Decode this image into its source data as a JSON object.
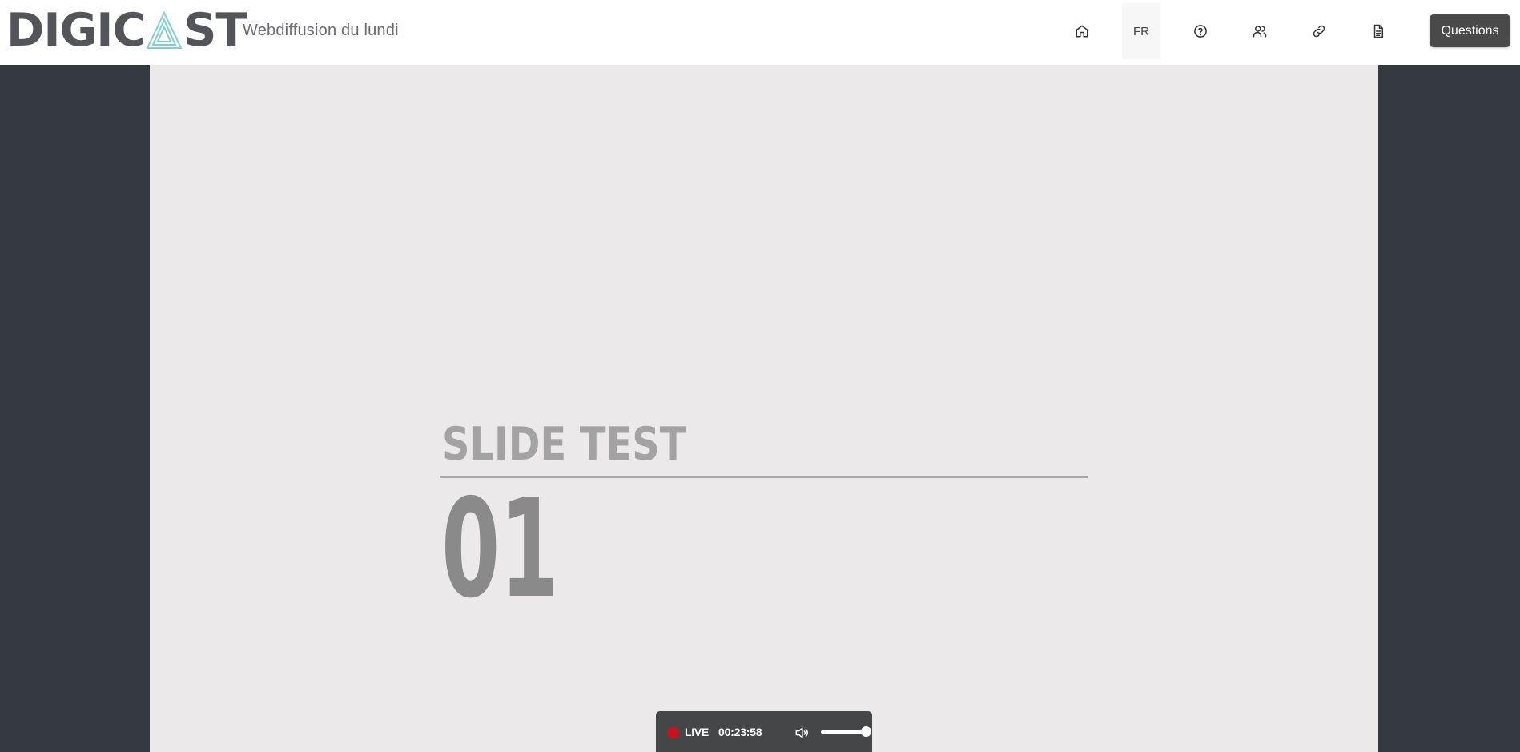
{
  "header": {
    "logo_left": "DIGIC",
    "logo_right": "ST",
    "event_title": "Webdiffusion du lundi",
    "language": "FR",
    "questions_label": "Questions",
    "nav_icons": [
      "home-icon",
      "help-circle-icon",
      "users-icon",
      "link-icon",
      "document-icon"
    ]
  },
  "slide": {
    "title": "SLIDE TEST",
    "number": "01"
  },
  "player": {
    "live_label": "LIVE",
    "elapsed": "00:23:58",
    "volume_level": 1.0
  },
  "colors": {
    "background": "#343a3f",
    "header": "#ffffff",
    "slide_bg": "#ebe9ea",
    "logo": "#54555b",
    "logo_accent": "#7fd1cf",
    "live_dot": "#c4141c",
    "questions_button": "#4a4a4a",
    "player_bar": "#454648"
  }
}
